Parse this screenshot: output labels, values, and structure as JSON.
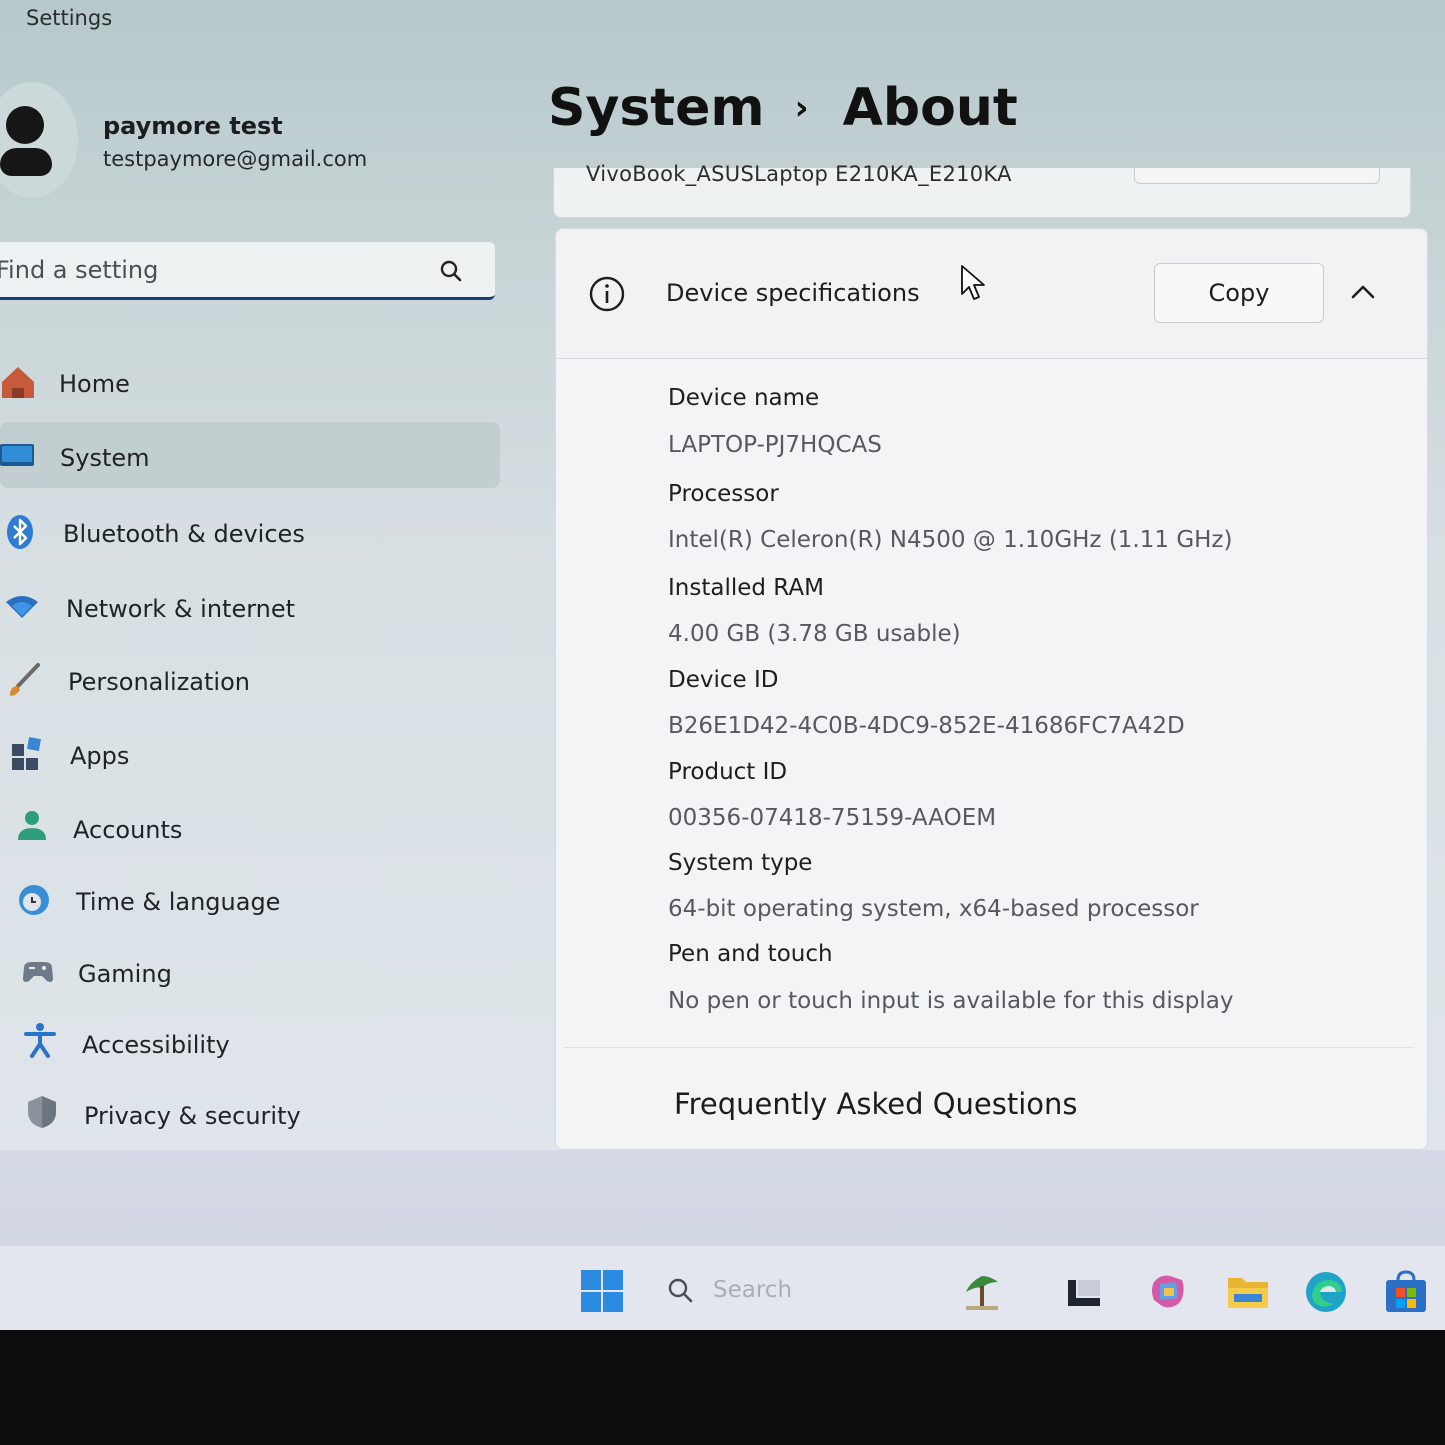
{
  "window": {
    "title": "Settings"
  },
  "profile": {
    "name": "paymore test",
    "email": "testpaymore@gmail.com"
  },
  "search": {
    "placeholder": "Find a setting"
  },
  "nav": {
    "items": [
      {
        "label": "Home",
        "icon": "home-icon"
      },
      {
        "label": "System",
        "icon": "monitor-icon",
        "active": true
      },
      {
        "label": "Bluetooth & devices",
        "icon": "bluetooth-icon"
      },
      {
        "label": "Network & internet",
        "icon": "wifi-icon"
      },
      {
        "label": "Personalization",
        "icon": "brush-icon"
      },
      {
        "label": "Apps",
        "icon": "apps-icon"
      },
      {
        "label": "Accounts",
        "icon": "person-icon"
      },
      {
        "label": "Time & language",
        "icon": "globe-clock-icon"
      },
      {
        "label": "Gaming",
        "icon": "controller-icon"
      },
      {
        "label": "Accessibility",
        "icon": "accessibility-icon"
      },
      {
        "label": "Privacy & security",
        "icon": "shield-icon"
      }
    ]
  },
  "header": {
    "breadcrumb_parent": "System",
    "separator": "›",
    "breadcrumb_current": "About"
  },
  "device_card": {
    "model": "VivoBook_ASUSLaptop E210KA_E210KA"
  },
  "specs": {
    "title": "Device specifications",
    "copy_label": "Copy",
    "rows": [
      {
        "label": "Device name",
        "value": "LAPTOP-PJ7HQCAS"
      },
      {
        "label": "Processor",
        "value": "Intel(R) Celeron(R) N4500 @ 1.10GHz (1.11 GHz)"
      },
      {
        "label": "Installed RAM",
        "value": "4.00 GB (3.78 GB usable)"
      },
      {
        "label": "Device ID",
        "value": "B26E1D42-4C0B-4DC9-852E-41686FC7A42D"
      },
      {
        "label": "Product ID",
        "value": "00356-07418-75159-AAOEM"
      },
      {
        "label": "System type",
        "value": "64-bit operating system, x64-based processor"
      },
      {
        "label": "Pen and touch",
        "value": "No pen or touch input is available for this display"
      }
    ]
  },
  "faq": {
    "title": "Frequently Asked Questions"
  },
  "taskbar": {
    "search_placeholder": "Search",
    "icons": [
      "start-icon",
      "search-icon",
      "widgets-icon",
      "task-view-icon",
      "copilot-icon",
      "file-explorer-icon",
      "edge-icon",
      "store-icon"
    ]
  },
  "colors": {
    "accent": "#1a3f78",
    "nav_active_bg": "#b4c3c3",
    "card_bg": "#f3f4f5"
  }
}
